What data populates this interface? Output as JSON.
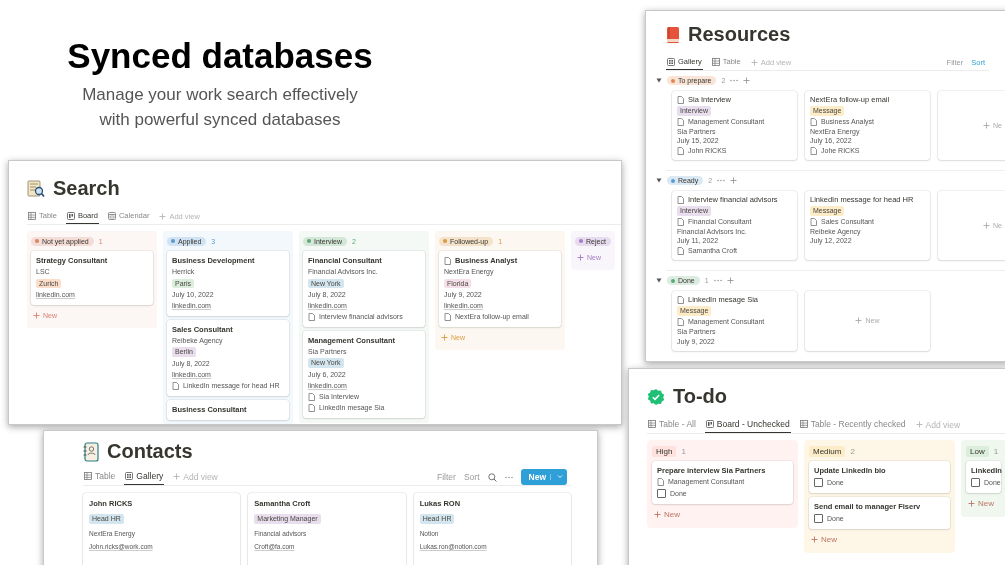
{
  "headline": {
    "title": "Synced databases",
    "subtitle": "Manage your work search effectively with powerful synced databases"
  },
  "search": {
    "title": "Search",
    "tabs": [
      {
        "kind": "table",
        "label": "Table",
        "selected": false
      },
      {
        "kind": "board",
        "label": "Board",
        "selected": true
      },
      {
        "kind": "calendar",
        "label": "Calendar",
        "selected": false
      }
    ],
    "add_view": "Add view",
    "columns": [
      {
        "status": "Not yet applied",
        "color": "#d9826c",
        "count": "1",
        "new": "New",
        "cards": [
          {
            "title": "Strategy Consultant",
            "page_icon": false,
            "lines": [
              {
                "kind": "text",
                "text": "LSC"
              },
              {
                "kind": "tag",
                "text": "Zurich",
                "color": "#fadec9"
              },
              {
                "kind": "link",
                "text": "linkedin.com"
              }
            ]
          }
        ]
      },
      {
        "status": "Applied",
        "color": "#5b9bd0",
        "count": "3",
        "cards": [
          {
            "title": "Business Development",
            "page_icon": false,
            "lines": [
              {
                "kind": "text",
                "text": "Herrick"
              },
              {
                "kind": "tag",
                "text": "Paris",
                "color": "#dbeddb"
              },
              {
                "kind": "text",
                "text": "July 10, 2022"
              },
              {
                "kind": "link",
                "text": "linkedin.com"
              }
            ]
          },
          {
            "title": "Sales Consultant",
            "page_icon": false,
            "lines": [
              {
                "kind": "text",
                "text": "Reibeke Agency"
              },
              {
                "kind": "tag",
                "text": "Berlin",
                "color": "#e8deee"
              },
              {
                "kind": "text",
                "text": "July 8, 2022"
              },
              {
                "kind": "link",
                "text": "linkedin.com"
              },
              {
                "kind": "doc",
                "text": "LinkedIn message for head HR"
              }
            ]
          },
          {
            "title": "Business Consultant",
            "page_icon": false
          }
        ]
      },
      {
        "status": "Interview",
        "color": "#5fa877",
        "count": "2",
        "cards": [
          {
            "title": "Financial Consultant",
            "page_icon": false,
            "lines": [
              {
                "kind": "text",
                "text": "Financial Advisors Inc."
              },
              {
                "kind": "tag",
                "text": "New York",
                "color": "#d3e5ef"
              },
              {
                "kind": "text",
                "text": "July 8, 2022"
              },
              {
                "kind": "link",
                "text": "linkedin.com"
              },
              {
                "kind": "doc",
                "text": "Interview financial advisors"
              }
            ]
          },
          {
            "title": "Management Consultant",
            "page_icon": false,
            "lines": [
              {
                "kind": "text",
                "text": "Sia Partners"
              },
              {
                "kind": "tag",
                "text": "New York",
                "color": "#d3e5ef"
              },
              {
                "kind": "text",
                "text": "July 6, 2022"
              },
              {
                "kind": "link",
                "text": "linkedin.com"
              },
              {
                "kind": "doc",
                "text": "Sia Interview"
              },
              {
                "kind": "doc",
                "text": "LinkedIn mesage Sia"
              }
            ]
          }
        ]
      },
      {
        "status": "Followed-up",
        "color": "#d99a3e",
        "count": "1",
        "new": "New",
        "cards": [
          {
            "title": "Business Analyst",
            "page_icon": true,
            "lines": [
              {
                "kind": "text",
                "text": "NextEra Energy"
              },
              {
                "kind": "tag",
                "text": "Florida",
                "color": "#f5e0e9"
              },
              {
                "kind": "text",
                "text": "July 9, 2022"
              },
              {
                "kind": "link",
                "text": "linkedin.com"
              },
              {
                "kind": "doc",
                "text": "NextEra follow-up email"
              }
            ]
          }
        ]
      },
      {
        "status": "Reject",
        "color": "#a77cc4",
        "new": "New"
      }
    ]
  },
  "resources": {
    "title": "Resources",
    "tabs": [
      {
        "kind": "gallery",
        "label": "Gallery",
        "selected": true
      },
      {
        "kind": "table",
        "label": "Table",
        "selected": false
      }
    ],
    "add_view": "Add view",
    "filter": "Filter",
    "sort": "Sort",
    "groups": [
      {
        "status": "To prepare",
        "color": "#e0884f",
        "count": "2",
        "cards": [
          {
            "kind": "card",
            "title": "Sia Interview",
            "page_icon": true,
            "lines": [
              {
                "kind": "tag",
                "text": "Interview",
                "color": "#e8deee"
              },
              {
                "kind": "doc",
                "text": "Management Consultant"
              },
              {
                "kind": "text",
                "text": "Sia Partners"
              },
              {
                "kind": "text",
                "text": "July 15, 2022"
              },
              {
                "kind": "doc",
                "text": "John RICKS"
              }
            ]
          },
          {
            "kind": "card",
            "title": "NextEra follow-up email",
            "page_icon": false,
            "lines": [
              {
                "kind": "tag",
                "text": "Message",
                "color": "#fdecc8"
              },
              {
                "kind": "doc",
                "text": "Business Analyst"
              },
              {
                "kind": "text",
                "text": "NextEra Energy"
              },
              {
                "kind": "text",
                "text": "July 16, 2022"
              },
              {
                "kind": "doc",
                "text": "Johe RICKS"
              }
            ]
          },
          {
            "kind": "new_cut",
            "label": "Ne"
          }
        ]
      },
      {
        "status": "Ready",
        "color": "#5b9bd0",
        "count": "2",
        "cards": [
          {
            "kind": "card",
            "title": "Interview financial advisors",
            "page_icon": true,
            "lines": [
              {
                "kind": "tag",
                "text": "Interview",
                "color": "#e8deee"
              },
              {
                "kind": "doc",
                "text": "Financial Consultant"
              },
              {
                "kind": "text",
                "text": "Financial Advisors Inc."
              },
              {
                "kind": "text",
                "text": "July 11, 2022"
              },
              {
                "kind": "doc",
                "text": "Samantha Croft"
              }
            ]
          },
          {
            "kind": "card",
            "title": "LinkedIn message for head HR",
            "page_icon": false,
            "lines": [
              {
                "kind": "tag",
                "text": "Message",
                "color": "#fdecc8"
              },
              {
                "kind": "doc",
                "text": "Sales Consultant"
              },
              {
                "kind": "text",
                "text": "Reibeke Agency"
              },
              {
                "kind": "text",
                "text": "July 12, 2022"
              }
            ]
          },
          {
            "kind": "new_cut",
            "label": "Ne"
          }
        ]
      },
      {
        "status": "Done",
        "color": "#5fa877",
        "count": "1",
        "cards": [
          {
            "kind": "card",
            "title": "LinkedIn mesage Sia",
            "page_icon": true,
            "lines": [
              {
                "kind": "tag",
                "text": "Message",
                "color": "#fdecc8"
              },
              {
                "kind": "doc",
                "text": "Management Consultant"
              },
              {
                "kind": "text",
                "text": "Sia Partners"
              },
              {
                "kind": "text",
                "text": "July 9, 2022"
              }
            ]
          },
          {
            "kind": "new",
            "label": "New"
          }
        ]
      }
    ]
  },
  "todo": {
    "title": "To-do",
    "tabs": [
      {
        "kind": "table",
        "label": "Table - All",
        "selected": false
      },
      {
        "kind": "board",
        "label": "Board - Unchecked",
        "selected": true
      },
      {
        "kind": "table",
        "label": "Table - Recently checked",
        "selected": false
      }
    ],
    "add_view": "Add view",
    "columns": [
      {
        "status": "High",
        "color": "#ffe2dd",
        "count": "1",
        "new": "New",
        "cards": [
          {
            "title": "Prepare interview Sia Partners",
            "page_icon": false,
            "lines": [
              {
                "kind": "doc",
                "text": "Management Consultant"
              },
              {
                "kind": "check",
                "text": "Done",
                "checked": false
              }
            ]
          }
        ]
      },
      {
        "status": "Medium",
        "color": "#fdecc8",
        "count": "2",
        "new": "New",
        "cards": [
          {
            "title": "Update LinkedIn bio",
            "page_icon": false,
            "lines": [
              {
                "kind": "check",
                "text": "Done",
                "checked": false
              }
            ]
          },
          {
            "title": "Send email to manager Fiserv",
            "page_icon": false,
            "lines": [
              {
                "kind": "check",
                "text": "Done",
                "checked": false
              }
            ]
          }
        ]
      },
      {
        "status": "Low",
        "color": "#dbeddb",
        "count": "1",
        "new": "New",
        "cards": [
          {
            "title": "LinkedIn",
            "page_icon": false,
            "lines": [
              {
                "kind": "check",
                "text": "Done",
                "checked": false
              }
            ]
          }
        ]
      }
    ]
  },
  "contacts": {
    "title": "Contacts",
    "tabs": [
      {
        "kind": "table",
        "label": "Table",
        "selected": false
      },
      {
        "kind": "gallery",
        "label": "Gallery",
        "selected": true
      }
    ],
    "add_view": "Add view",
    "filter": "Filter",
    "sort": "Sort",
    "new_button": "New",
    "cards": [
      {
        "name": "John RICKS",
        "tag": {
          "text": "Head HR",
          "color": "#d3e5ef"
        },
        "company": "NextEra Energy",
        "email": "John.ricks@work.com"
      },
      {
        "name": "Samantha Croft",
        "tag": {
          "text": "Marketing Manager",
          "color": "#e8deee"
        },
        "company": "Financial advisors",
        "email": "Croft@fa.com"
      },
      {
        "name": "Lukas RON",
        "tag": {
          "text": "Head HR",
          "color": "#d3e5ef"
        },
        "company": "Notion",
        "email": "Lukas.ron@notion.com"
      }
    ]
  }
}
